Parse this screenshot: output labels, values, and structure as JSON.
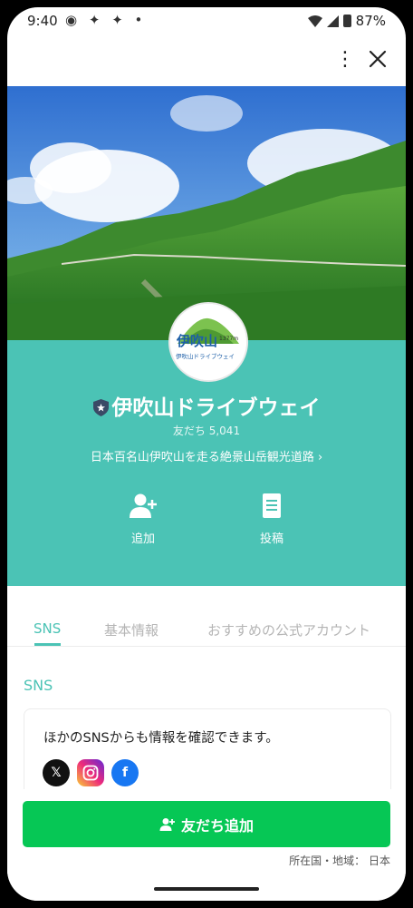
{
  "status_bar": {
    "time": "9:40",
    "left_icons": "◉ ✦ ✦ •",
    "battery": "87%"
  },
  "topbar": {
    "menu_icon": "⋮"
  },
  "profile": {
    "logo_text": "伊吹山",
    "logo_subtext": "伊吹山ドライブウェイ",
    "logo_height": "1377m",
    "name": "伊吹山ドライブウェイ",
    "friends": "友だち 5,041",
    "description": "日本百名山伊吹山を走る絶景山岳観光道路 ›",
    "actions": [
      {
        "label": "追加",
        "icon": "add-friend-icon"
      },
      {
        "label": "投稿",
        "icon": "post-icon"
      }
    ]
  },
  "tabs": [
    {
      "label": "SNS",
      "active": true
    },
    {
      "label": "基本情報",
      "active": false
    },
    {
      "label": "おすすめの公式アカウント",
      "active": false
    }
  ],
  "sns_section": {
    "title": "SNS",
    "text": "ほかのSNSからも情報を確認できます。",
    "icons": [
      {
        "name": "x-icon",
        "glyph": "𝕏"
      },
      {
        "name": "instagram-icon",
        "glyph": "◎"
      },
      {
        "name": "facebook-icon",
        "glyph": "f"
      }
    ]
  },
  "footer": {
    "add_button": "友だち追加",
    "region": "所在国・地域： 日本"
  },
  "colors": {
    "accent": "#4bc3b5",
    "line_green": "#06c755"
  }
}
